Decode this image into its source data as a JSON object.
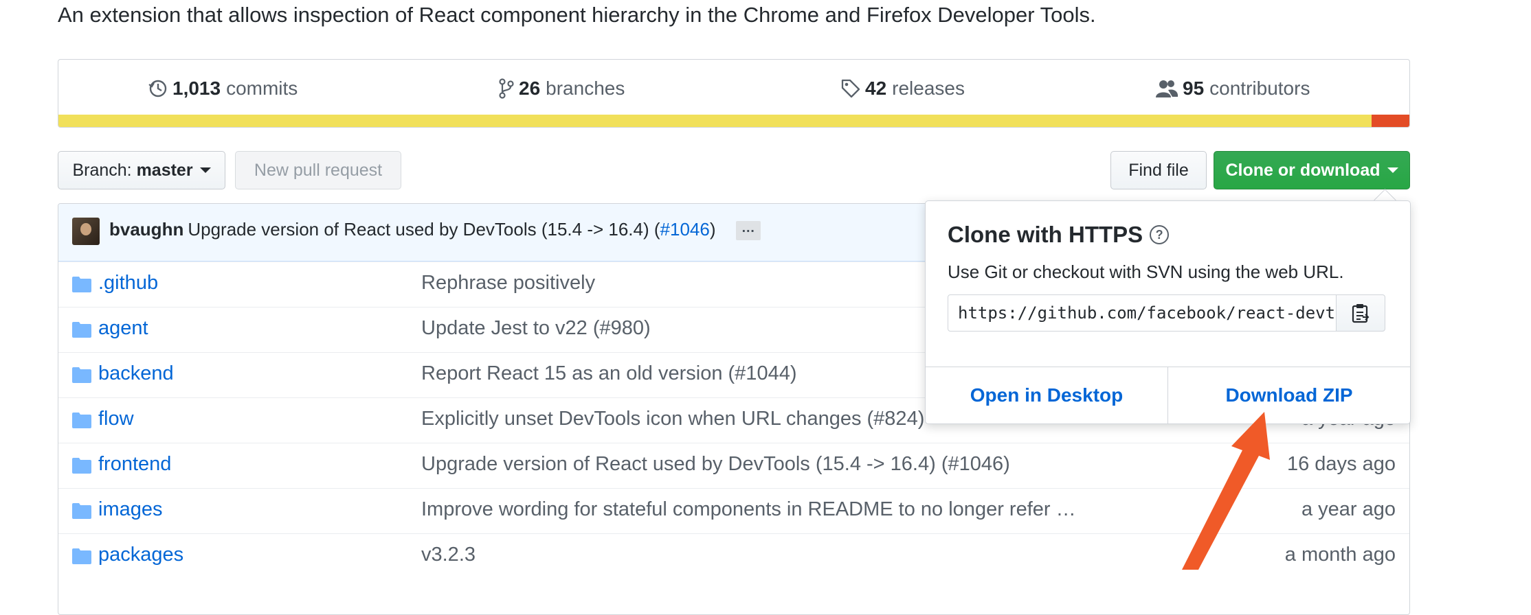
{
  "repo": {
    "description": "An extension that allows inspection of React component hierarchy in the Chrome and Firefox Developer Tools."
  },
  "stats": {
    "commits": {
      "count": "1,013",
      "label": "commits",
      "icon": "history-icon"
    },
    "branches": {
      "count": "26",
      "label": "branches",
      "icon": "git-branch-icon"
    },
    "releases": {
      "count": "42",
      "label": "releases",
      "icon": "tag-icon"
    },
    "contributors": {
      "count": "95",
      "label": "contributors",
      "icon": "people-icon"
    }
  },
  "languages": [
    {
      "color": "#f1e05a",
      "percent": 97.2
    },
    {
      "color": "#e34c26",
      "percent": 2.8
    }
  ],
  "toolbar": {
    "branch_prefix": "Branch:",
    "branch_name": "master",
    "new_pr": "New pull request",
    "find_file": "Find file",
    "clone_download": "Clone or download"
  },
  "latest_commit": {
    "author": "bvaughn",
    "message": "Upgrade version of React used by DevTools (15.4 -> 16.4) (",
    "pr": "#1046",
    "close": ")",
    "ellipsis": "…"
  },
  "files": [
    {
      "name": ".github",
      "message": "Rephrase positively",
      "age": ""
    },
    {
      "name": "agent",
      "message": "Update Jest to v22 (#980)",
      "age": ""
    },
    {
      "name": "backend",
      "message": "Report React 15 as an old version (#1044)",
      "age": ""
    },
    {
      "name": "flow",
      "message": "Explicitly unset DevTools icon when URL changes (#824)",
      "age": "a year ago"
    },
    {
      "name": "frontend",
      "message": "Upgrade version of React used by DevTools (15.4 -> 16.4) (#1046)",
      "age": "16 days ago"
    },
    {
      "name": "images",
      "message": "Improve wording for stateful components in README to no longer refer …",
      "age": "a year ago"
    },
    {
      "name": "packages",
      "message": "v3.2.3",
      "age": "a month ago"
    }
  ],
  "clone_popover": {
    "title": "Clone with HTTPS",
    "subtitle": "Use Git or checkout with SVN using the web URL.",
    "url": "https://github.com/facebook/react-devtools.git",
    "open_desktop": "Open in Desktop",
    "download_zip": "Download ZIP"
  },
  "colors": {
    "link": "#0366d6",
    "green_button": "#28a745",
    "annotation_arrow": "#f05a28"
  }
}
